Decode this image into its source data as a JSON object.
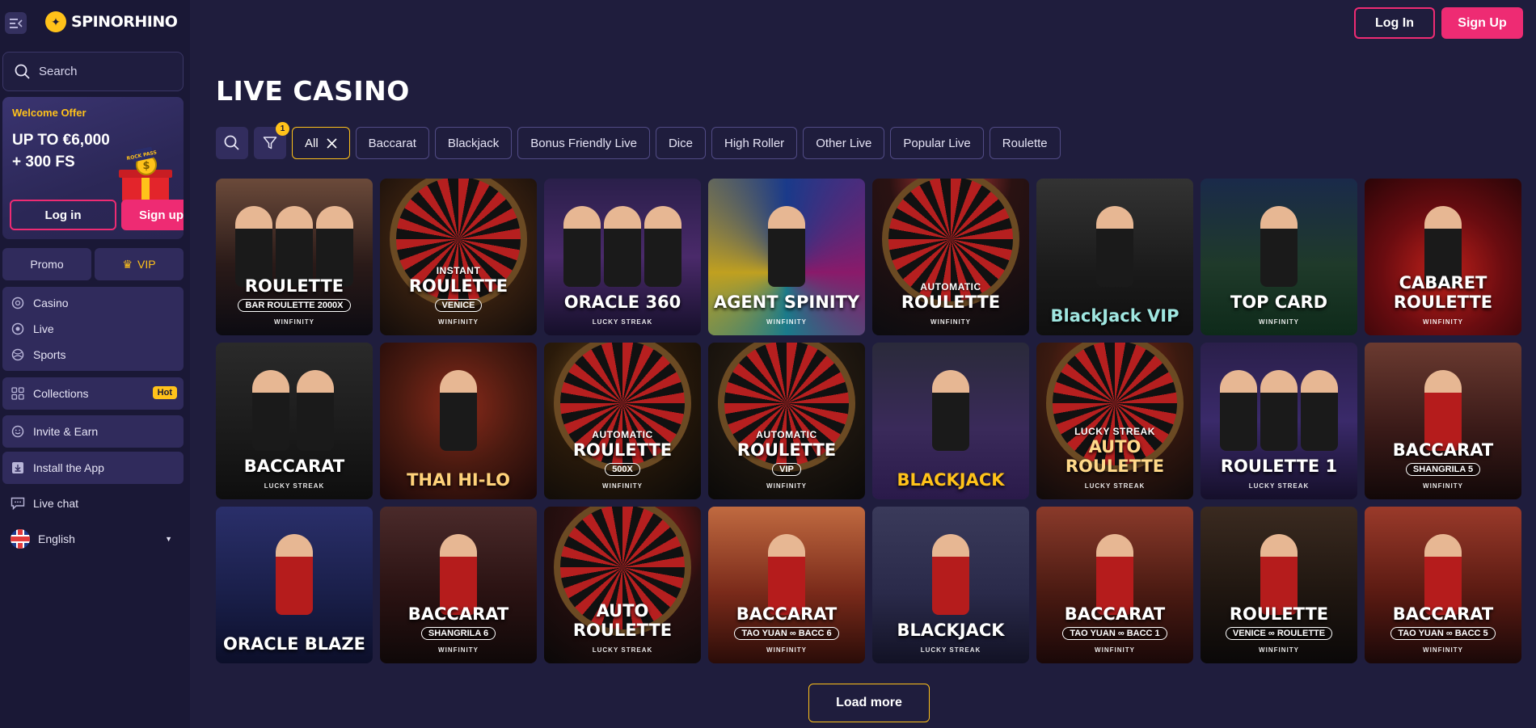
{
  "brand": {
    "name": "SPINORHINO"
  },
  "sidebar": {
    "search_placeholder": "Search",
    "promo": {
      "tag": "Welcome Offer",
      "line1": "UP TO €6,000",
      "line2": "+ 300 FS",
      "gift_label": "ROCK PASS",
      "login": "Log in",
      "signup": "Sign up"
    },
    "pills": {
      "promo": "Promo",
      "vip": "VIP"
    },
    "nav": [
      "Casino",
      "Live",
      "Sports"
    ],
    "collections": "Collections",
    "hot": "Hot",
    "invite": "Invite & Earn",
    "install": "Install the App",
    "live_chat": "Live chat",
    "language": "English"
  },
  "header": {
    "login": "Log In",
    "signup": "Sign Up"
  },
  "page": {
    "title": "LIVE CASINO"
  },
  "filters": {
    "badge_count": "1",
    "chips": [
      "All",
      "Baccarat",
      "Blackjack",
      "Bonus Friendly Live",
      "Dice",
      "High Roller",
      "Other Live",
      "Popular Live",
      "Roulette"
    ]
  },
  "games": [
    {
      "t1": "",
      "t2": "ROULETTE",
      "t3": "BAR ROULETTE 2000X",
      "prov": "WINFINITY"
    },
    {
      "t1": "INSTANT",
      "t2": "ROULETTE",
      "t3": "VENICE",
      "prov": "WINFINITY"
    },
    {
      "t1": "",
      "t2": "ORACLE 360",
      "t3": "",
      "prov": "LUCKY STREAK"
    },
    {
      "t1": "",
      "t2": "AGENT SPINITY",
      "t3": "",
      "prov": "WINFINITY"
    },
    {
      "t1": "AUTOMATIC",
      "t2": "ROULETTE",
      "t3": "",
      "prov": "WINFINITY"
    },
    {
      "t1": "",
      "t2": "BlackJack VIP",
      "t3": "",
      "prov": ""
    },
    {
      "t1": "",
      "t2": "TOP CARD",
      "t3": "",
      "prov": "WINFINITY"
    },
    {
      "t1": "",
      "t2": "CABARET ROULETTE",
      "t3": "",
      "prov": "WINFINITY"
    },
    {
      "t1": "",
      "t2": "BACCARAT",
      "t3": "",
      "prov": "LUCKY STREAK"
    },
    {
      "t1": "",
      "t2": "THAI HI-LO",
      "t3": "",
      "prov": ""
    },
    {
      "t1": "AUTOMATIC",
      "t2": "ROULETTE",
      "t3": "500X",
      "prov": "WINFINITY"
    },
    {
      "t1": "AUTOMATIC",
      "t2": "ROULETTE",
      "t3": "VIP",
      "prov": "WINFINITY"
    },
    {
      "t1": "",
      "t2": "BLACKJACK",
      "t3": "",
      "prov": ""
    },
    {
      "t1": "LUCKY STREAK",
      "t2": "AUTO ROULETTE",
      "t3": "",
      "prov": "LUCKY STREAK"
    },
    {
      "t1": "",
      "t2": "ROULETTE 1",
      "t3": "",
      "prov": "LUCKY STREAK"
    },
    {
      "t1": "",
      "t2": "BACCARAT",
      "t3": "SHANGRILA 5",
      "prov": "WINFINITY"
    },
    {
      "t1": "",
      "t2": "ORACLE BLAZE",
      "t3": "",
      "prov": ""
    },
    {
      "t1": "",
      "t2": "BACCARAT",
      "t3": "SHANGRILA 6",
      "prov": "WINFINITY"
    },
    {
      "t1": "",
      "t2": "AUTO ROULETTE",
      "t3": "",
      "prov": "LUCKY STREAK"
    },
    {
      "t1": "",
      "t2": "BACCARAT",
      "t3": "TAO YUAN ∞ BACC 6",
      "prov": "WINFINITY"
    },
    {
      "t1": "",
      "t2": "BLACKJACK",
      "t3": "",
      "prov": "LUCKY STREAK"
    },
    {
      "t1": "",
      "t2": "BACCARAT",
      "t3": "TAO YUAN ∞ BACC 1",
      "prov": "WINFINITY"
    },
    {
      "t1": "",
      "t2": "ROULETTE",
      "t3": "VENICE ∞ ROULETTE",
      "prov": "WINFINITY"
    },
    {
      "t1": "",
      "t2": "BACCARAT",
      "t3": "TAO YUAN ∞ BACC 5",
      "prov": "WINFINITY"
    }
  ],
  "load_more": "Load more",
  "colors": {
    "accent_pink": "#ee2b73",
    "accent_gold": "#ffc21a",
    "bg": "#1f1d3d"
  }
}
